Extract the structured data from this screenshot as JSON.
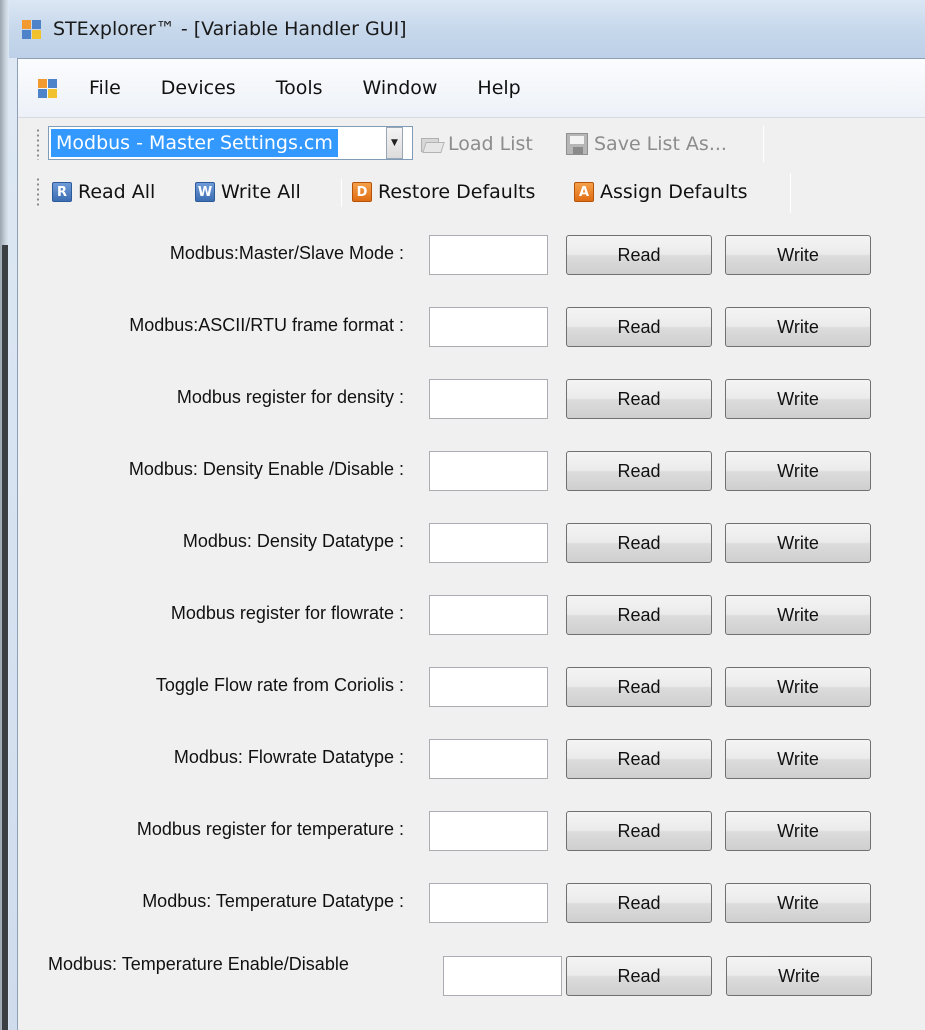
{
  "window": {
    "title": "STExplorer™ - [Variable Handler GUI]"
  },
  "menu": {
    "items": [
      "File",
      "Devices",
      "Tools",
      "Window",
      "Help"
    ]
  },
  "toolbar": {
    "combo_value": "Modbus - Master Settings.cm",
    "load_list": "Load List",
    "save_list_as": "Save List As...",
    "read_all": "Read All",
    "write_all": "Write All",
    "restore_defaults": "Restore Defaults",
    "assign_defaults": "Assign Defaults",
    "read_all_icon": "R",
    "write_all_icon": "W",
    "restore_defaults_icon": "D",
    "assign_defaults_icon": "A"
  },
  "variables": [
    {
      "label": "Modbus:Master/Slave Mode :",
      "value": "",
      "read": "Read",
      "write": "Write"
    },
    {
      "label": "Modbus:ASCII/RTU frame format :",
      "value": "",
      "read": "Read",
      "write": "Write"
    },
    {
      "label": "Modbus register for density :",
      "value": "",
      "read": "Read",
      "write": "Write"
    },
    {
      "label": "Modbus: Density Enable /Disable :",
      "value": "",
      "read": "Read",
      "write": "Write"
    },
    {
      "label": "Modbus: Density Datatype :",
      "value": "",
      "read": "Read",
      "write": "Write"
    },
    {
      "label": "Modbus register for flowrate :",
      "value": "",
      "read": "Read",
      "write": "Write"
    },
    {
      "label": "Toggle Flow rate from Coriolis :",
      "value": "",
      "read": "Read",
      "write": "Write"
    },
    {
      "label": "Modbus: Flowrate Datatype :",
      "value": "",
      "read": "Read",
      "write": "Write"
    },
    {
      "label": "Modbus register for temperature :",
      "value": "",
      "read": "Read",
      "write": "Write"
    },
    {
      "label": "Modbus: Temperature Datatype :",
      "value": "",
      "read": "Read",
      "write": "Write"
    },
    {
      "label": "Modbus: Temperature Enable/Disable",
      "value": "",
      "read": "Read",
      "write": "Write"
    }
  ]
}
